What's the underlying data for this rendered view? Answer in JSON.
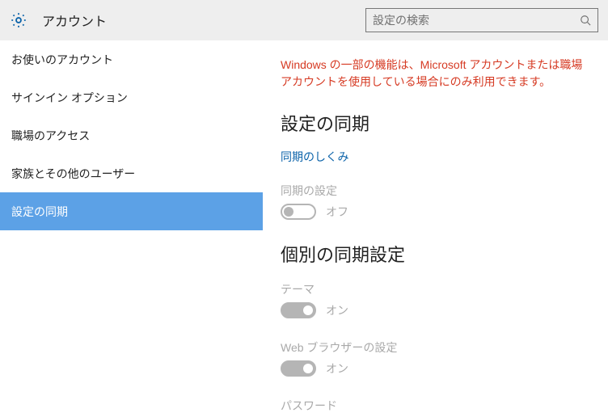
{
  "header": {
    "title": "アカウント",
    "search_placeholder": "設定の検索"
  },
  "sidebar": {
    "items": [
      {
        "label": "お使いのアカウント",
        "selected": false
      },
      {
        "label": "サインイン オプション",
        "selected": false
      },
      {
        "label": "職場のアクセス",
        "selected": false
      },
      {
        "label": "家族とその他のユーザー",
        "selected": false
      },
      {
        "label": "設定の同期",
        "selected": true
      }
    ]
  },
  "content": {
    "alert": "Windows の一部の機能は、Microsoft アカウントまたは職場アカウントを使用している場合にのみ利用できます。",
    "section_title": "設定の同期",
    "link": "同期のしくみ",
    "sync_settings": {
      "label": "同期の設定",
      "state_text": "オフ",
      "on": false
    },
    "subsection_title": "個別の同期設定",
    "individual": [
      {
        "label": "テーマ",
        "state_text": "オン",
        "on": true
      },
      {
        "label": "Web ブラウザーの設定",
        "state_text": "オン",
        "on": true
      },
      {
        "label": "パスワード",
        "state_text": "",
        "on": true
      }
    ]
  }
}
